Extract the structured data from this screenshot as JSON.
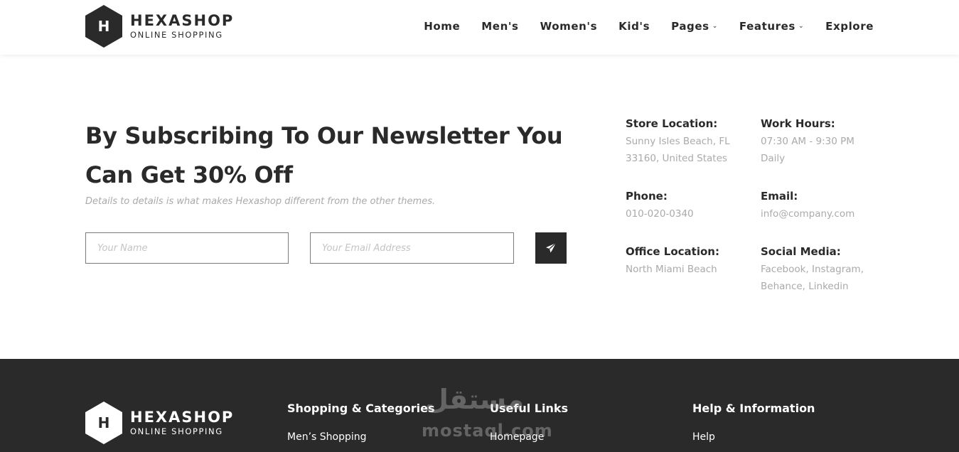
{
  "brand": {
    "letter": "H",
    "title": "HEXASHOP",
    "subtitle": "ONLINE SHOPPING"
  },
  "nav": {
    "items": [
      {
        "label": "Home",
        "dropdown": false
      },
      {
        "label": "Men's",
        "dropdown": false
      },
      {
        "label": "Women's",
        "dropdown": false
      },
      {
        "label": "Kid's",
        "dropdown": false
      },
      {
        "label": "Pages",
        "dropdown": true
      },
      {
        "label": "Features",
        "dropdown": true
      },
      {
        "label": "Explore",
        "dropdown": false
      }
    ]
  },
  "newsletter": {
    "headline": "By Subscribing To Our Newsletter You Can Get 30% Off",
    "subtext": "Details to details is what makes Hexashop different from the other themes.",
    "name_placeholder": "Your Name",
    "email_placeholder": "Your Email Address",
    "send_icon": "paper-plane-icon"
  },
  "contact": {
    "store_label": "Store Location:",
    "store_line1": "Sunny Isles Beach, FL",
    "store_line2": "33160, United States",
    "hours_label": "Work Hours:",
    "hours_line1": "07:30 AM - 9:30 PM",
    "hours_line2": "Daily",
    "phone_label": "Phone:",
    "phone_value": "010-020-0340",
    "email_label": "Email:",
    "email_value": "info@company.com",
    "office_label": "Office Location:",
    "office_value": "North Miami Beach",
    "social_label": "Social Media:",
    "social_line1": "Facebook, Instagram,",
    "social_line2": "Behance, Linkedin"
  },
  "footer": {
    "col1_title": "Shopping & Categories",
    "col1_link": "Men’s Shopping",
    "col2_title": "Useful Links",
    "col2_link": "Homepage",
    "col3_title": "Help & Information",
    "col3_link": "Help"
  },
  "watermark": {
    "arabic": "مستقل",
    "latin": "mostaql.com"
  },
  "colors": {
    "dark": "#2a2a2a",
    "muted": "#aaaaaa",
    "white": "#ffffff"
  }
}
